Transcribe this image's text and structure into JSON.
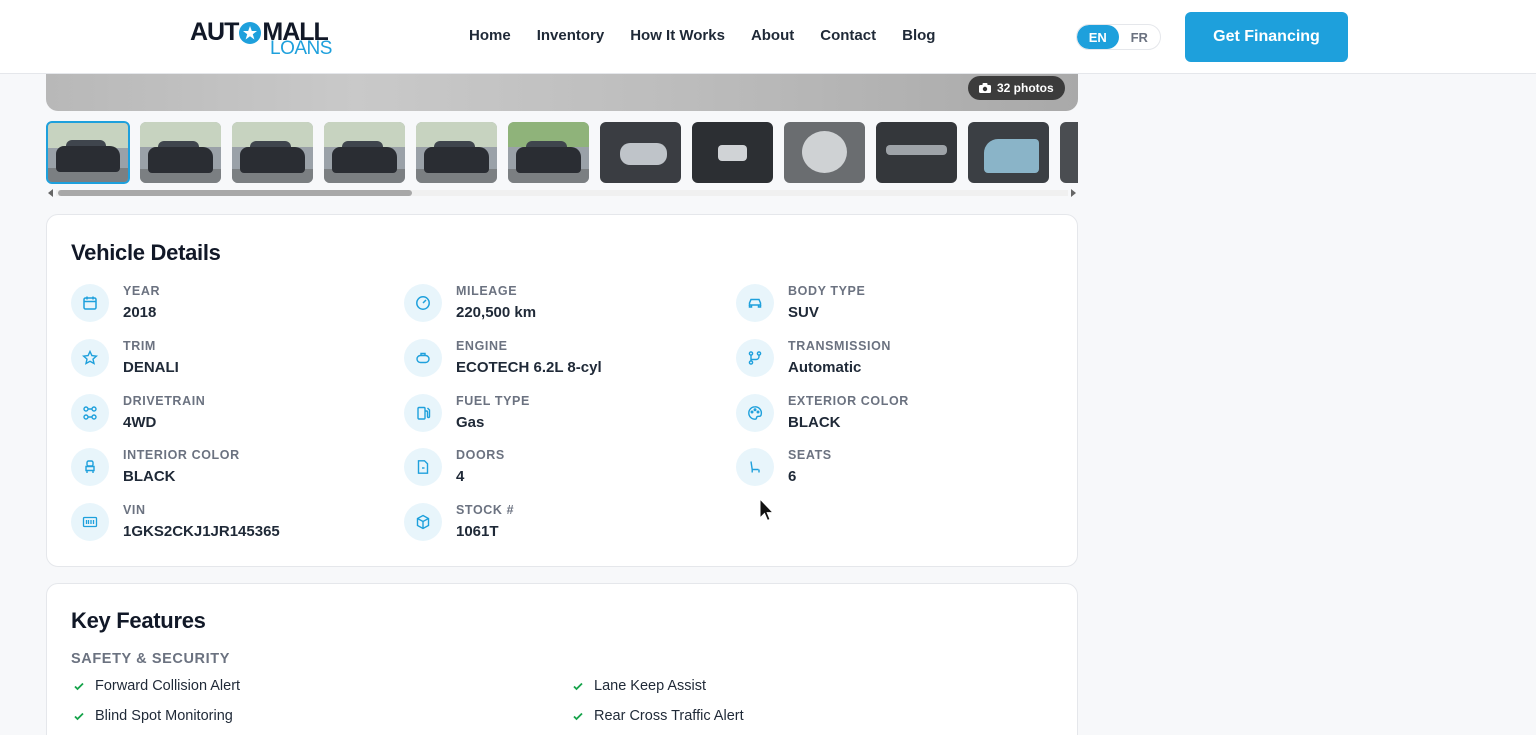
{
  "header": {
    "logo_top_left": "AUT",
    "logo_top_right": "MALL",
    "logo_bottom": "LOANS",
    "nav": [
      "Home",
      "Inventory",
      "How It Works",
      "About",
      "Contact",
      "Blog"
    ],
    "lang_en": "EN",
    "lang_fr": "FR",
    "cta_label": "Get Financing",
    "accent_color": "#1ea0dc"
  },
  "gallery": {
    "photo_count_label": "32 photos",
    "thumbnail_count_visible": 12
  },
  "vehicle_details": {
    "title": "Vehicle Details",
    "specs": [
      {
        "label": "YEAR",
        "value": "2018",
        "icon": "calendar-icon"
      },
      {
        "label": "MILEAGE",
        "value": "220,500 km",
        "icon": "gauge-icon"
      },
      {
        "label": "BODY TYPE",
        "value": "SUV",
        "icon": "car-icon"
      },
      {
        "label": "TRIM",
        "value": "DENALI",
        "icon": "star-icon"
      },
      {
        "label": "ENGINE",
        "value": "ECOTECH 6.2L 8-cyl",
        "icon": "engine-icon"
      },
      {
        "label": "TRANSMISSION",
        "value": "Automatic",
        "icon": "transmission-icon"
      },
      {
        "label": "DRIVETRAIN",
        "value": "4WD",
        "icon": "drivetrain-icon"
      },
      {
        "label": "FUEL TYPE",
        "value": "Gas",
        "icon": "fuel-icon"
      },
      {
        "label": "EXTERIOR COLOR",
        "value": "BLACK",
        "icon": "palette-icon"
      },
      {
        "label": "INTERIOR COLOR",
        "value": "BLACK",
        "icon": "car-seat-icon"
      },
      {
        "label": "DOORS",
        "value": "4",
        "icon": "door-icon"
      },
      {
        "label": "SEATS",
        "value": "6",
        "icon": "seat-icon"
      },
      {
        "label": "VIN",
        "value": "1GKS2CKJ1JR145365",
        "icon": "barcode-icon"
      },
      {
        "label": "STOCK #",
        "value": "1061T",
        "icon": "box-icon"
      }
    ]
  },
  "key_features": {
    "title": "Key Features",
    "group": "SAFETY & SECURITY",
    "items": [
      "Forward Collision Alert",
      "Lane Keep Assist",
      "Blind Spot Monitoring",
      "Rear Cross Traffic Alert"
    ]
  }
}
